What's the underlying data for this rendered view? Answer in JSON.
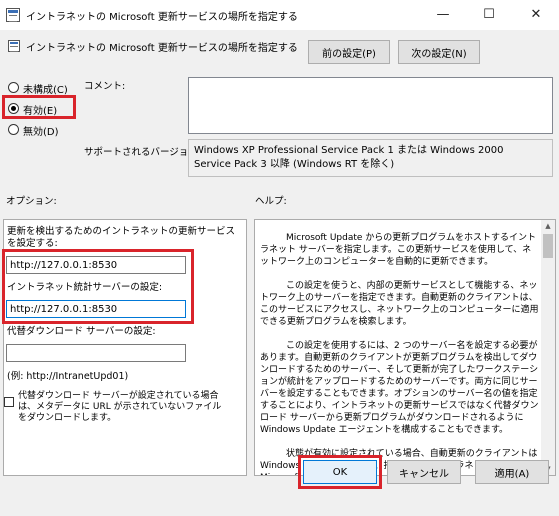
{
  "window": {
    "title": "イントラネットの Microsoft 更新サービスの場所を指定する",
    "minimize": "—",
    "maximize": "☐",
    "close": "✕"
  },
  "header": {
    "title": "イントラネットの Microsoft 更新サービスの場所を指定する",
    "prev_button": "前の設定(P)",
    "next_button": "次の設定(N)"
  },
  "state": {
    "options": [
      {
        "label": "未構成(C)",
        "selected": false
      },
      {
        "label": "有効(E)",
        "selected": true
      },
      {
        "label": "無効(D)",
        "selected": false
      }
    ]
  },
  "comment": {
    "label": "コメント:",
    "value": ""
  },
  "supported": {
    "label": "サポートされるバージョン:",
    "text": "Windows XP Professional Service Pack 1 または Windows 2000 Service Pack 3 以降 (Windows RT を除く)"
  },
  "options_section": {
    "heading": "オプション:",
    "update_service_label": "更新を検出するためのイントラネットの更新サービスを設定する:",
    "update_service_value": "http://127.0.0.1:8530",
    "stats_server_label": "イントラネット統計サーバーの設定:",
    "stats_server_value": "http://127.0.0.1:8530",
    "alt_download_label": "代替ダウンロード サーバーの設定:",
    "alt_download_value": "",
    "example": "(例: http://IntranetUpd01)",
    "checkbox_label": "代替ダウンロード サーバーが設定されている場合は、メタデータに URL が示されていないファイルをダウンロードします。",
    "checkbox_checked": false
  },
  "help_section": {
    "heading": "ヘルプ:",
    "paragraphs": [
      "Microsoft Update からの更新プログラムをホストするイントラネット サーバーを指定します。この更新サービスを使用して、ネットワーク上のコンピューターを自動的に更新できます。",
      "この設定を使うと、内部の更新サービスとして機能する、ネットワーク上のサーバーを指定できます。自動更新のクライアントは、このサービスにアクセスし、ネットワーク上のコンピューターに適用できる更新プログラムを検索します。",
      "この設定を使用するには、2 つのサーバー名を設定する必要があります。自動更新のクライアントが更新プログラムを検出してダウンロードするためのサーバー、そして更新が完了したワークステーションが統計をアップロードするためのサーバーです。両方に同じサーバーを設定することもできます。オプションのサーバー名の値を指定することにより、イントラネットの更新サービスではなく代替ダウンロード サーバーから更新プログラムがダウンロードされるように Windows Update エージェントを構成することもできます。",
      "状態が有効に設定されている場合、自動更新のクライアントは Windows Update ではなく、指定されたイントラネットの Microsoft 更"
    ]
  },
  "footer": {
    "ok": "OK",
    "cancel": "キャンセル",
    "apply": "適用(A)"
  },
  "colors": {
    "highlight": "#d9242b",
    "focus_border": "#0078d7",
    "window_bg": "#f0f0f0"
  }
}
